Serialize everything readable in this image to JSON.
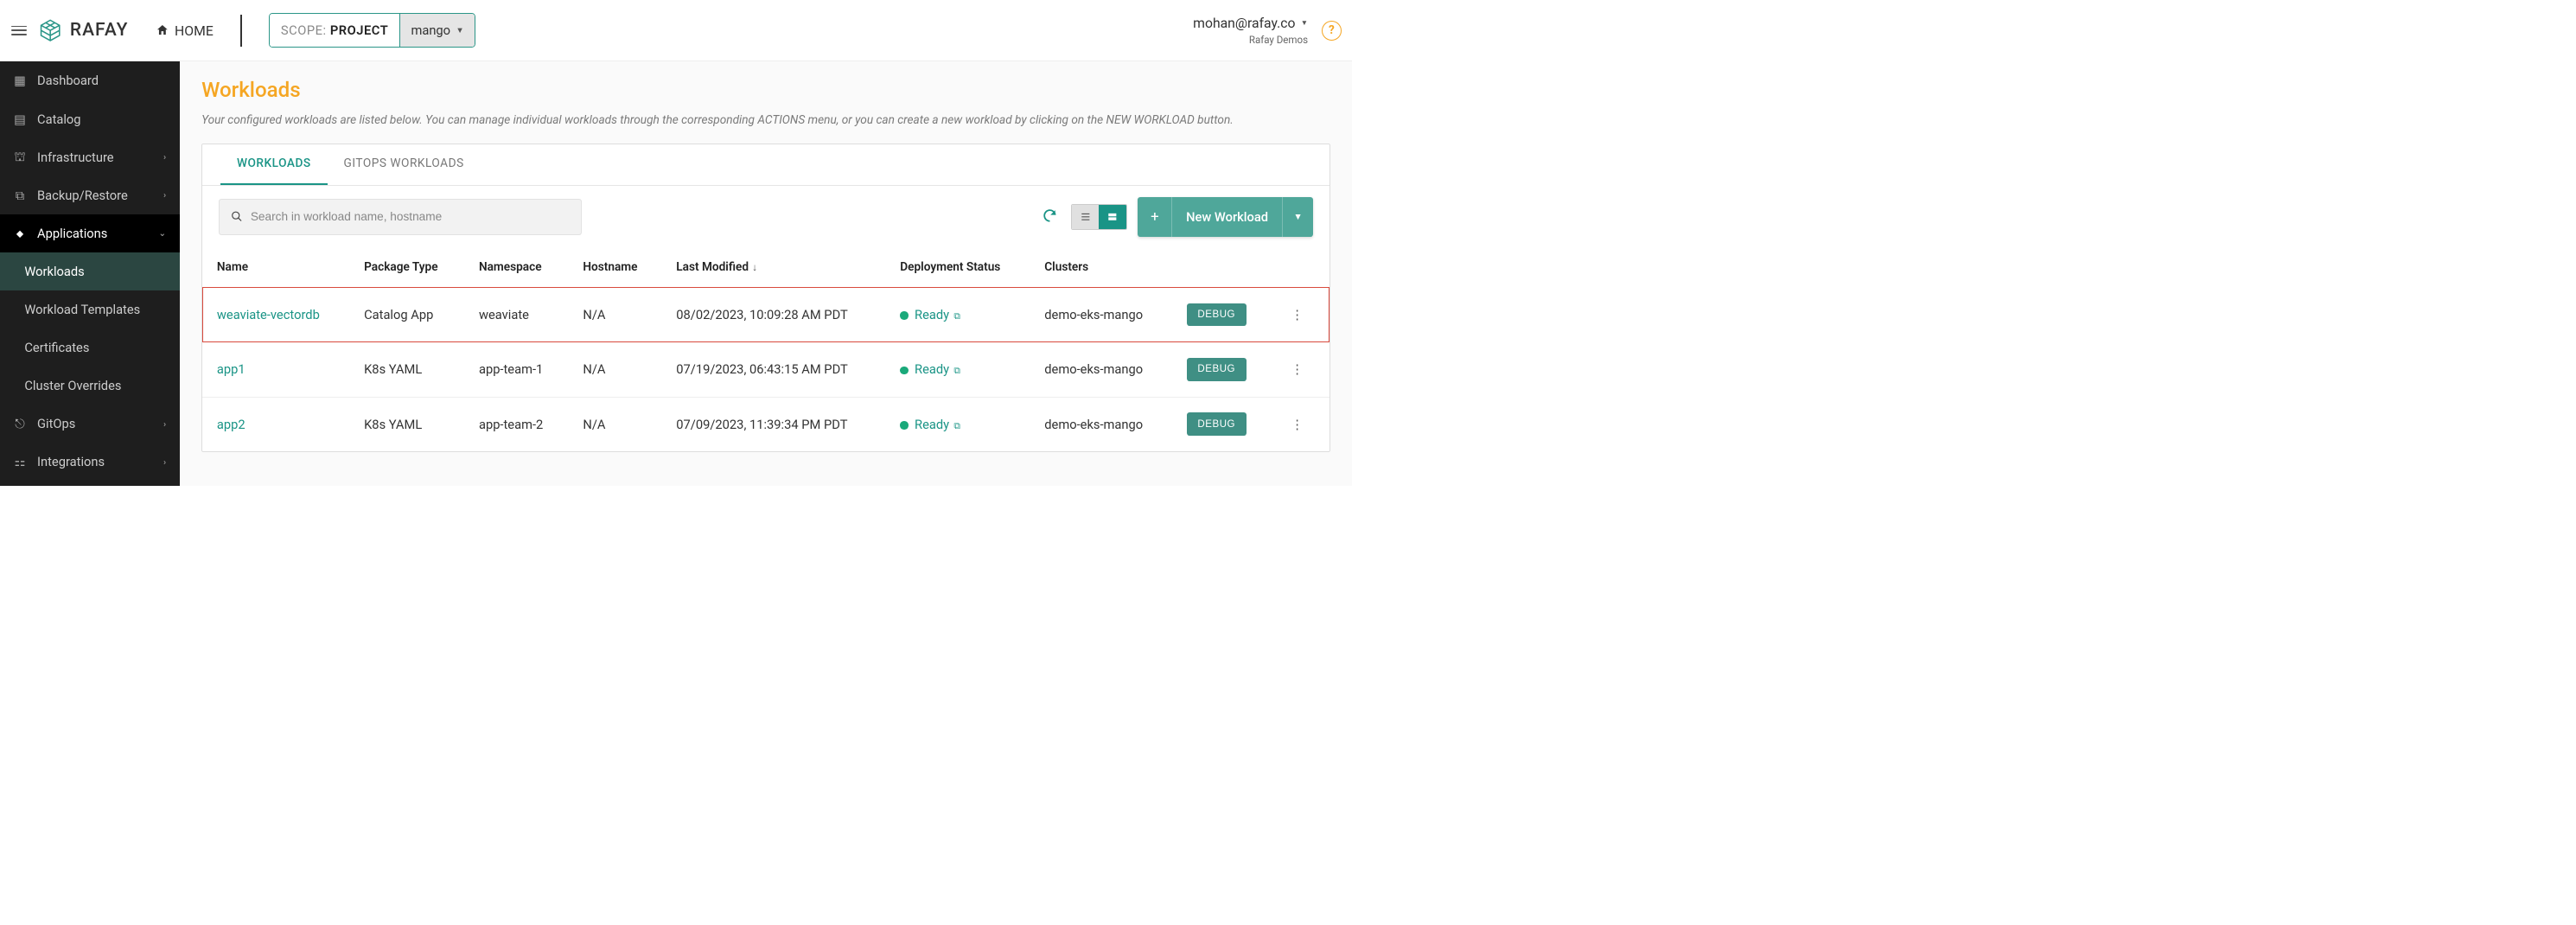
{
  "header": {
    "home_label": "HOME",
    "scope_label": "SCOPE:",
    "scope_value": "PROJECT",
    "scope_project": "mango",
    "user_email": "mohan@rafay.co",
    "user_org": "Rafay Demos"
  },
  "brand": "RAFAY",
  "sidebar": {
    "items": [
      {
        "label": "Dashboard",
        "icon": "grid"
      },
      {
        "label": "Catalog",
        "icon": "apps"
      },
      {
        "label": "Infrastructure",
        "icon": "building",
        "chev": true
      },
      {
        "label": "Backup/Restore",
        "icon": "copy",
        "chev": true
      },
      {
        "label": "Applications",
        "icon": "briefcase",
        "chev": true,
        "active_parent": true
      },
      {
        "label": "GitOps",
        "icon": "git",
        "chev": true
      },
      {
        "label": "Integrations",
        "icon": "plug",
        "chev": true
      }
    ],
    "app_children": [
      {
        "label": "Workloads",
        "active": true
      },
      {
        "label": "Workload Templates"
      },
      {
        "label": "Certificates"
      },
      {
        "label": "Cluster Overrides"
      }
    ]
  },
  "page": {
    "title": "Workloads",
    "description": "Your configured workloads are listed below. You can manage individual workloads through the corresponding ACTIONS menu, or you can create a new workload by clicking on the NEW WORKLOAD button."
  },
  "tabs": [
    {
      "label": "WORKLOADS",
      "active": true
    },
    {
      "label": "GITOPS WORKLOADS"
    }
  ],
  "toolbar": {
    "search_placeholder": "Search in workload name, hostname",
    "new_workload_label": "New Workload"
  },
  "columns": [
    "Name",
    "Package Type",
    "Namespace",
    "Hostname",
    "Last Modified",
    "Deployment Status",
    "Clusters"
  ],
  "rows": [
    {
      "name": "weaviate-vectordb",
      "package": "Catalog App",
      "namespace": "weaviate",
      "hostname": "N/A",
      "modified": "08/02/2023, 10:09:28 AM PDT",
      "status": "Ready",
      "clusters": "demo-eks-mango",
      "debug": "DEBUG",
      "highlight": true
    },
    {
      "name": "app1",
      "package": "K8s YAML",
      "namespace": "app-team-1",
      "hostname": "N/A",
      "modified": "07/19/2023, 06:43:15 AM PDT",
      "status": "Ready",
      "clusters": "demo-eks-mango",
      "debug": "DEBUG"
    },
    {
      "name": "app2",
      "package": "K8s YAML",
      "namespace": "app-team-2",
      "hostname": "N/A",
      "modified": "07/09/2023, 11:39:34 PM PDT",
      "status": "Ready",
      "clusters": "demo-eks-mango",
      "debug": "DEBUG"
    }
  ]
}
